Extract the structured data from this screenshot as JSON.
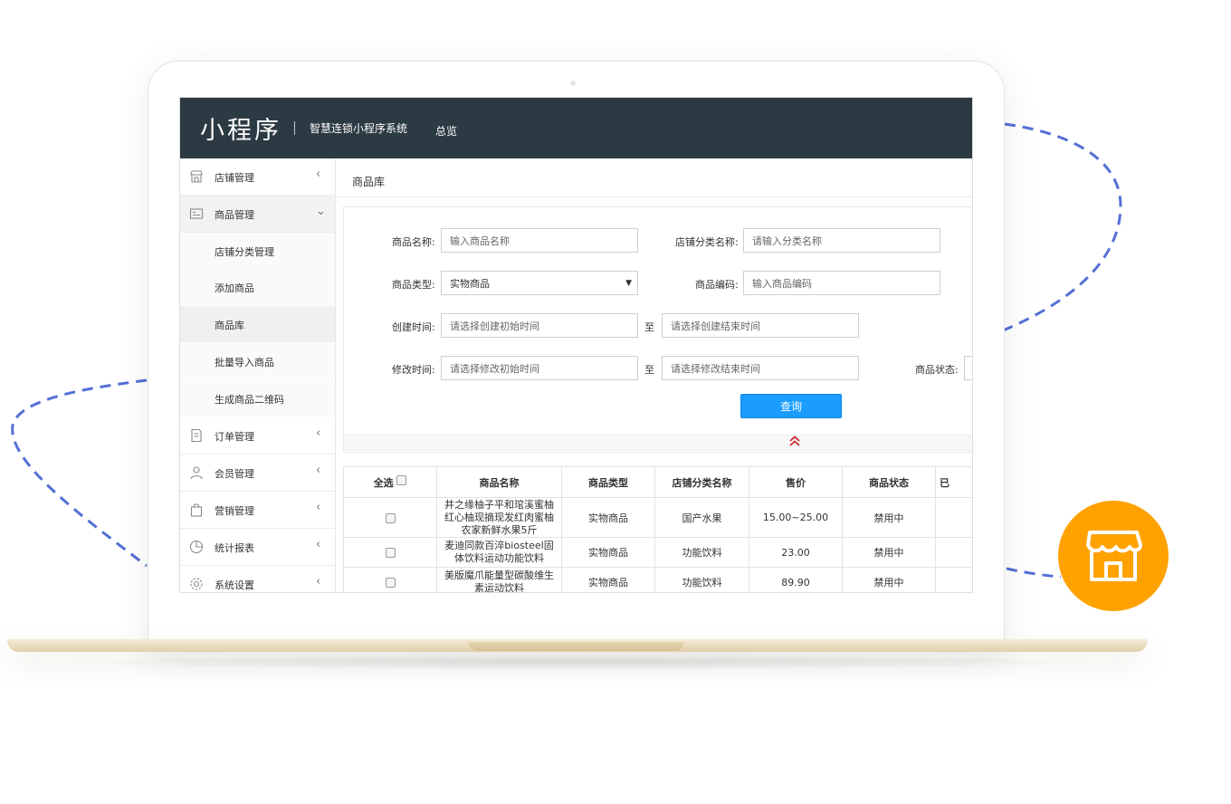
{
  "header": {
    "logo": "小程序",
    "system_name": "智慧连锁小程序系统",
    "nav_overview": "总览"
  },
  "sidebar": {
    "items": [
      {
        "label": "店铺管理",
        "icon": "store-icon",
        "arrow": "‹"
      },
      {
        "label": "商品管理",
        "icon": "product-icon",
        "arrow": "⌄"
      },
      {
        "label": "订单管理",
        "icon": "order-icon",
        "arrow": "‹"
      },
      {
        "label": "会员管理",
        "icon": "member-icon",
        "arrow": "‹"
      },
      {
        "label": "营销管理",
        "icon": "marketing-icon",
        "arrow": "‹"
      },
      {
        "label": "统计报表",
        "icon": "chart-icon",
        "arrow": "‹"
      },
      {
        "label": "系统设置",
        "icon": "gear-icon",
        "arrow": "‹"
      }
    ],
    "sub_items": [
      {
        "label": "店铺分类管理"
      },
      {
        "label": "添加商品"
      },
      {
        "label": "商品库"
      },
      {
        "label": "批量导入商品"
      },
      {
        "label": "生成商品二维码"
      }
    ]
  },
  "breadcrumb": "商品库",
  "filters": {
    "product_name": {
      "label": "商品名称:",
      "placeholder": "输入商品名称"
    },
    "store_category": {
      "label": "店铺分类名称:",
      "placeholder": "请输入分类名称"
    },
    "product_type": {
      "label": "商品类型:",
      "value": "实物商品"
    },
    "product_code": {
      "label": "商品编码:",
      "placeholder": "输入商品编码"
    },
    "created_time": {
      "label": "创建时间:",
      "start_placeholder": "请选择创建初始时间",
      "end_placeholder": "请选择创建结束时间"
    },
    "modified_time": {
      "label": "修改时间:",
      "start_placeholder": "请选择修改初始时间",
      "end_placeholder": "请选择修改结束时间"
    },
    "status_label": "商品状态:",
    "to_label": "至",
    "search_button": "查询"
  },
  "table": {
    "headers": [
      "全选",
      "商品名称",
      "商品类型",
      "店铺分类名称",
      "售价",
      "商品状态",
      "已"
    ],
    "rows": [
      {
        "name": "井之缘柚子平和琯溪蜜柚红心柚现摘现发红肉蜜柚农家新鲜水果5斤",
        "type": "实物商品",
        "category": "国产水果",
        "price": "15.00~25.00",
        "status": "禁用中"
      },
      {
        "name": "麦迪同款百淬biosteel固体饮料运动功能饮料",
        "type": "实物商品",
        "category": "功能饮料",
        "price": "23.00",
        "status": "禁用中"
      },
      {
        "name": "美版魔爪能量型碳酸维生素运动饮料",
        "type": "实物商品",
        "category": "功能饮料",
        "price": "89.90",
        "status": "禁用中"
      }
    ]
  },
  "colors": {
    "topbar": "#2c3a43",
    "primary_button": "#1a9dff",
    "badge": "#ffa200",
    "dashed_line": "#5470d6"
  }
}
